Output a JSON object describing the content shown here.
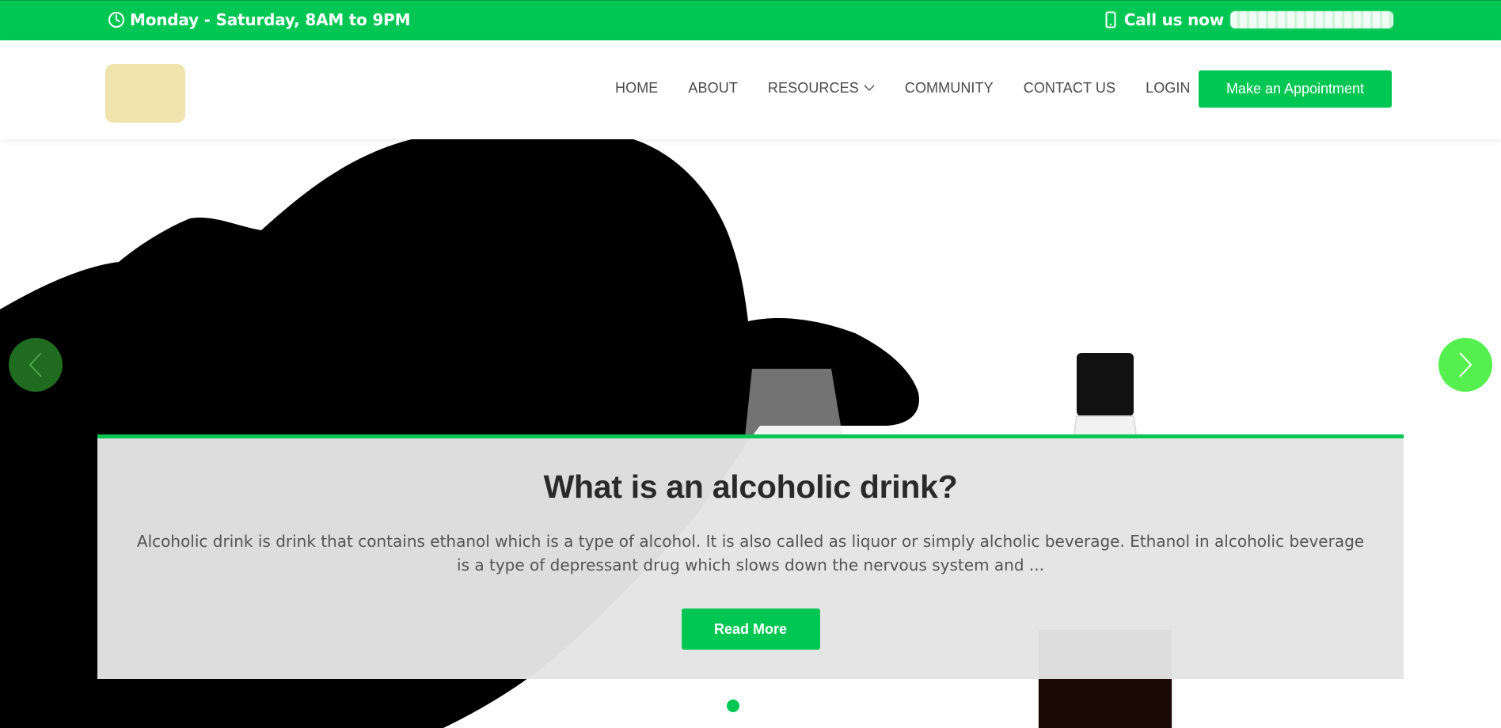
{
  "topbar": {
    "hours": "Monday - Saturday, 8AM to 9PM",
    "call_label": "Call us now"
  },
  "nav": {
    "items": [
      "HOME",
      "ABOUT",
      "RESOURCES",
      "COMMUNITY",
      "CONTACT US",
      "LOGIN"
    ],
    "cta": "Make an Appointment"
  },
  "hero": {
    "title": "What is an alcoholic drink?",
    "text": "Alcoholic drink is drink that contains ethanol which is a type of alcohol. It is also called as liquor or simply alcholic beverage. Ethanol in alcoholic beverage is a type of depressant drug which slows down the nervous system and ...",
    "button": "Read More"
  },
  "colors": {
    "brand": "#00c753",
    "prev_arrow": "#1f6b1f",
    "next_arrow": "#55f04f",
    "logo_placeholder": "#efe4ae"
  },
  "icons": [
    "clock-icon",
    "mobile-phone-icon",
    "chevron-down-icon",
    "chevron-left-icon",
    "chevron-right-icon"
  ]
}
